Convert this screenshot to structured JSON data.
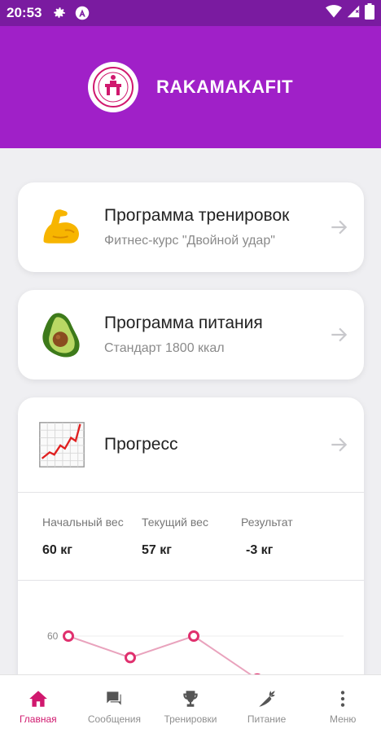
{
  "status_bar": {
    "time": "20:53"
  },
  "header": {
    "brand": "RAKAMAKAFIT"
  },
  "cards": [
    {
      "title": "Программа тренировок",
      "subtitle": "Фитнес-курс \"Двойной удар\"",
      "icon": "flexed-biceps-icon"
    },
    {
      "title": "Программа питания",
      "subtitle": "Стандарт 1800 ккал",
      "icon": "avocado-icon"
    }
  ],
  "progress": {
    "title": "Прогресс",
    "icon": "chart-increasing-icon",
    "stats": [
      {
        "label": "Начальный вес",
        "value": "60 кг"
      },
      {
        "label": "Текущий вес",
        "value": "57 кг"
      },
      {
        "label": "Результат",
        "value": "-3 кг"
      }
    ]
  },
  "chart_data": {
    "type": "line",
    "y_tick_labels": [
      "60"
    ],
    "series": [
      {
        "values": [
          60,
          58.9,
          60,
          57.8
        ]
      }
    ],
    "color": "#e0306e"
  },
  "bottom_nav": [
    {
      "label": "Главная",
      "icon": "home-icon",
      "active": true
    },
    {
      "label": "Сообщения",
      "icon": "messages-icon",
      "active": false
    },
    {
      "label": "Тренировки",
      "icon": "trophy-icon",
      "active": false
    },
    {
      "label": "Питание",
      "icon": "carrot-icon",
      "active": false
    },
    {
      "label": "Меню",
      "icon": "more-vertical-icon",
      "active": false
    }
  ],
  "colors": {
    "header": "#a020c8",
    "status_bar": "#7a1ba0",
    "accent": "#d0186e"
  }
}
